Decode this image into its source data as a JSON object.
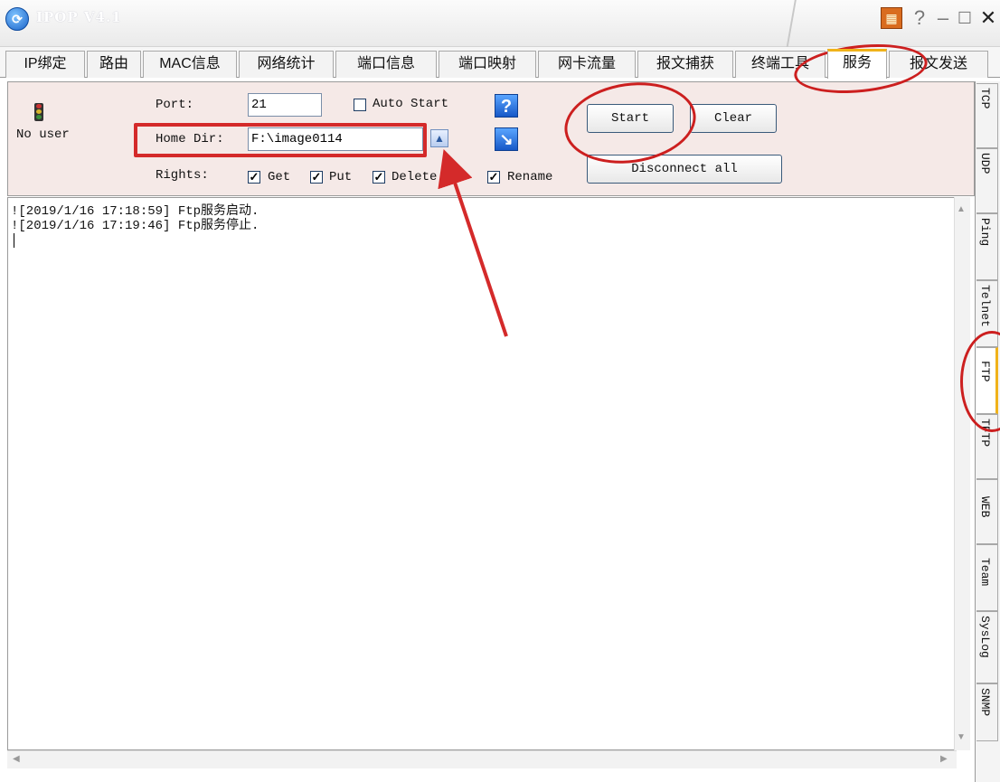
{
  "app": {
    "title": "IPOP V4.1"
  },
  "tabs": [
    "IP绑定",
    "路由",
    "MAC信息",
    "网络统计",
    "端口信息",
    "端口映射",
    "网卡流量",
    "报文捕获",
    "终端工具",
    "服务",
    "报文发送"
  ],
  "active_tab": "服务",
  "panel": {
    "status": "No user",
    "port_label": "Port:",
    "port_value": "21",
    "auto_start_label": "Auto Start",
    "home_dir_label": "Home Dir:",
    "home_dir_value": "F:\\image0114",
    "rights_label": "Rights:",
    "rights": {
      "get": "Get",
      "put": "Put",
      "delete": "Delete",
      "rename": "Rename"
    },
    "start_label": "Start",
    "clear_label": "Clear",
    "disconnect_label": "Disconnect all",
    "help_glyph": "?"
  },
  "log": [
    "![2019/1/16 17:18:59] Ftp服务启动.",
    "![2019/1/16 17:19:46] Ftp服务停止."
  ],
  "side_tabs": [
    "TCP",
    "UDP",
    "Ping",
    "Telnet",
    "FTP",
    "TFTP",
    "WEB",
    "Team",
    "SysLog",
    "SNMP"
  ],
  "active_side_tab": "FTP",
  "colors": {
    "panel_bg": "#f5e9e7",
    "annotation_red": "#d42a2a",
    "active_tab_accent": "#f0b21a"
  }
}
